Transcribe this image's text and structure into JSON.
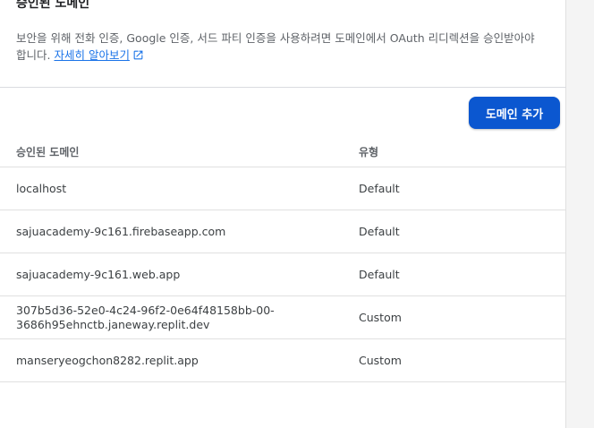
{
  "section": {
    "title": "승인된 도메인",
    "description": "보안을 위해 전화 인증, Google 인증, 서드 파티 인증을 사용하려면 도메인에서 OAuth 리디렉션을 승인받아야 합니다.",
    "learn_more_label": "자세히 알아보기"
  },
  "toolbar": {
    "add_domain_label": "도메인 추가",
    "accent_color": "#0b57d0"
  },
  "table": {
    "headers": {
      "domain": "승인된 도메인",
      "type": "유형"
    },
    "rows": [
      {
        "domain": "localhost",
        "type": "Default"
      },
      {
        "domain": "sajuacademy-9c161.firebaseapp.com",
        "type": "Default"
      },
      {
        "domain": "sajuacademy-9c161.web.app",
        "type": "Default"
      },
      {
        "domain_line1": "307b5d36-52e0-4c24-96f2-0e64f48158bb-00-",
        "domain_line2": "3686h95ehnctb.janeway.replit.dev",
        "type": "Custom"
      },
      {
        "domain": "manseryeogchon8282.replit.app",
        "type": "Custom"
      }
    ]
  },
  "icons": {
    "learn_more": "open-in-new-icon"
  }
}
